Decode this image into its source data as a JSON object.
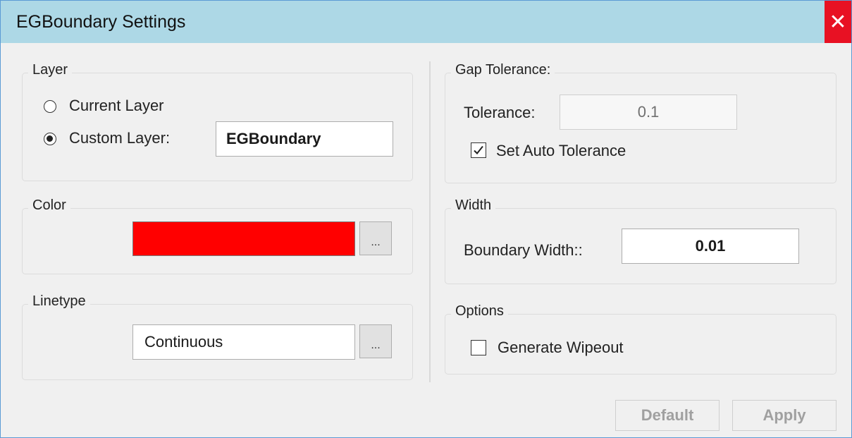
{
  "window": {
    "title": "EGBoundary Settings",
    "close_label": "✕"
  },
  "layer": {
    "legend": "Layer",
    "current_label": "Current Layer",
    "custom_label": "Custom Layer:",
    "custom_value": "EGBoundary",
    "selected": "custom"
  },
  "color": {
    "legend": "Color",
    "swatch_color": "#ff0000",
    "browse_label": "..."
  },
  "linetype": {
    "legend": "Linetype",
    "value": "Continuous",
    "browse_label": "..."
  },
  "gap": {
    "legend": "Gap Tolerance:",
    "tolerance_label": "Tolerance:",
    "tolerance_value": "0.1",
    "auto_label": "Set Auto Tolerance",
    "auto_checked": true
  },
  "width": {
    "legend": "Width",
    "label": "Boundary Width::",
    "value": "0.01"
  },
  "options": {
    "legend": "Options",
    "wipeout_label": "Generate Wipeout",
    "wipeout_checked": false
  },
  "buttons": {
    "default_label": "Default",
    "apply_label": "Apply"
  },
  "colors": {
    "titlebar": "#add8e6",
    "close": "#e81123"
  }
}
